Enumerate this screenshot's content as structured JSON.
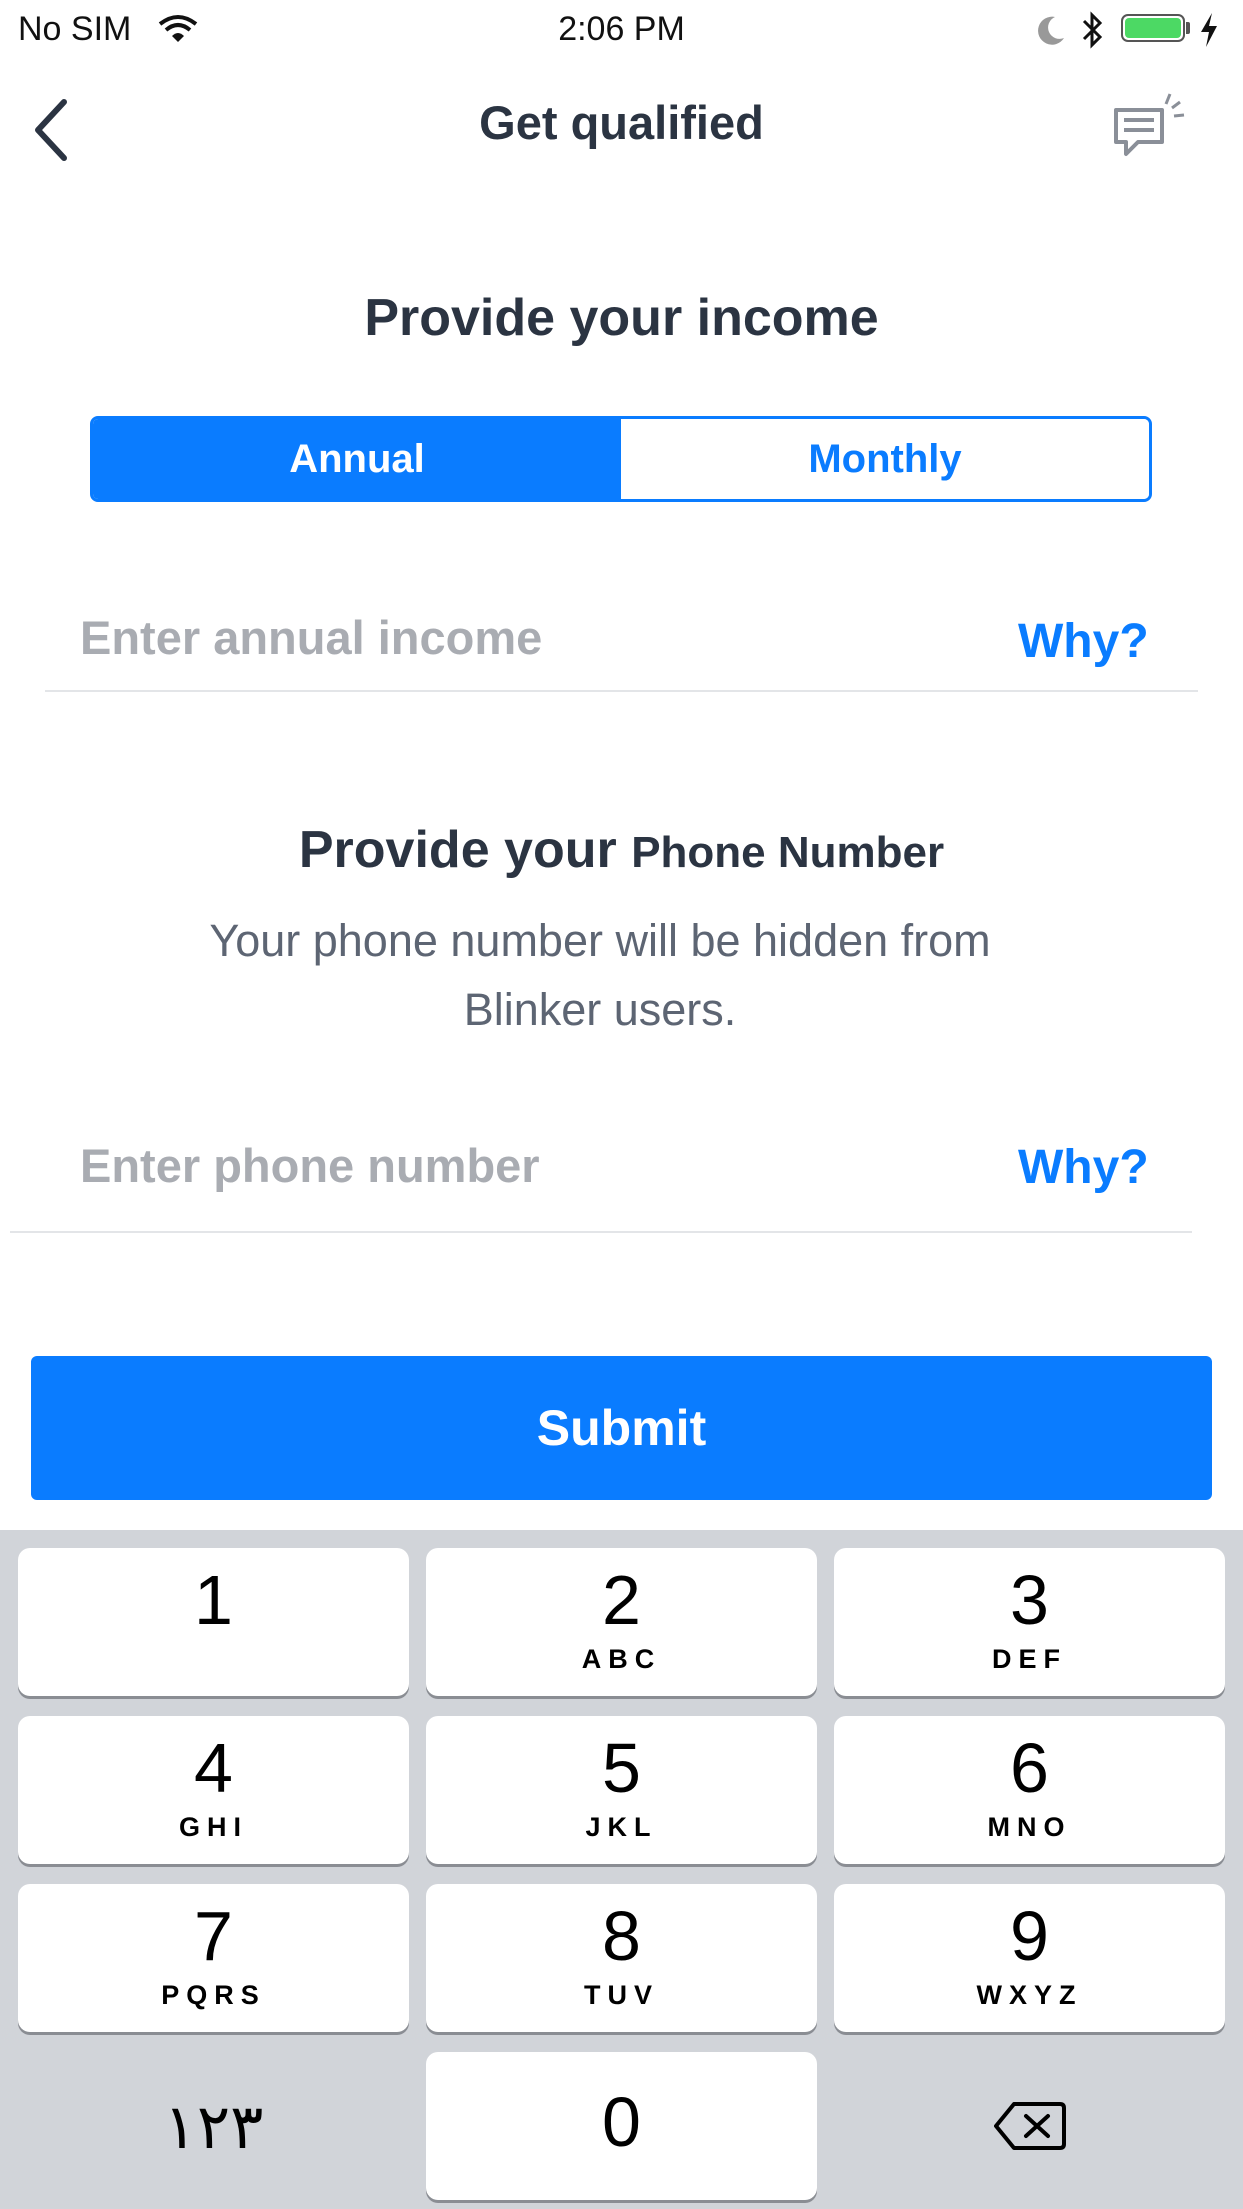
{
  "status_bar": {
    "carrier": "No SIM",
    "time": "2:06 PM",
    "battery_level": 1.0,
    "icons": [
      "wifi-icon",
      "moon-icon",
      "bluetooth-icon",
      "battery-icon",
      "charging-icon"
    ]
  },
  "nav": {
    "title": "Get qualified",
    "back_icon": "chevron-left-icon",
    "chat_icon": "chat-icon"
  },
  "income": {
    "title": "Provide your income",
    "segments": [
      "Annual",
      "Monthly"
    ],
    "selected_segment": "Annual",
    "placeholder": "Enter annual income",
    "why": "Why?"
  },
  "phone": {
    "title_main": "Provide your ",
    "title_small": "Phone Number",
    "subtext_line1": "Your phone number will be hidden from",
    "subtext_line2": "Blinker users.",
    "placeholder": "Enter phone number",
    "why": "Why?"
  },
  "submit_label": "Submit",
  "keypad": {
    "keys": [
      {
        "digit": "1",
        "letters": ""
      },
      {
        "digit": "2",
        "letters": "ABC"
      },
      {
        "digit": "3",
        "letters": "DEF"
      },
      {
        "digit": "4",
        "letters": "GHI"
      },
      {
        "digit": "5",
        "letters": "JKL"
      },
      {
        "digit": "6",
        "letters": "MNO"
      },
      {
        "digit": "7",
        "letters": "PQRS"
      },
      {
        "digit": "8",
        "letters": "TUV"
      },
      {
        "digit": "9",
        "letters": "WXYZ"
      }
    ],
    "zero": "0",
    "alt_label": "١٢٣",
    "delete_icon": "backspace-icon"
  },
  "colors": {
    "accent": "#0a7cff",
    "title_text": "#2b3442",
    "placeholder": "#a9acb2",
    "keyboard_bg": "#d1d4d9"
  }
}
